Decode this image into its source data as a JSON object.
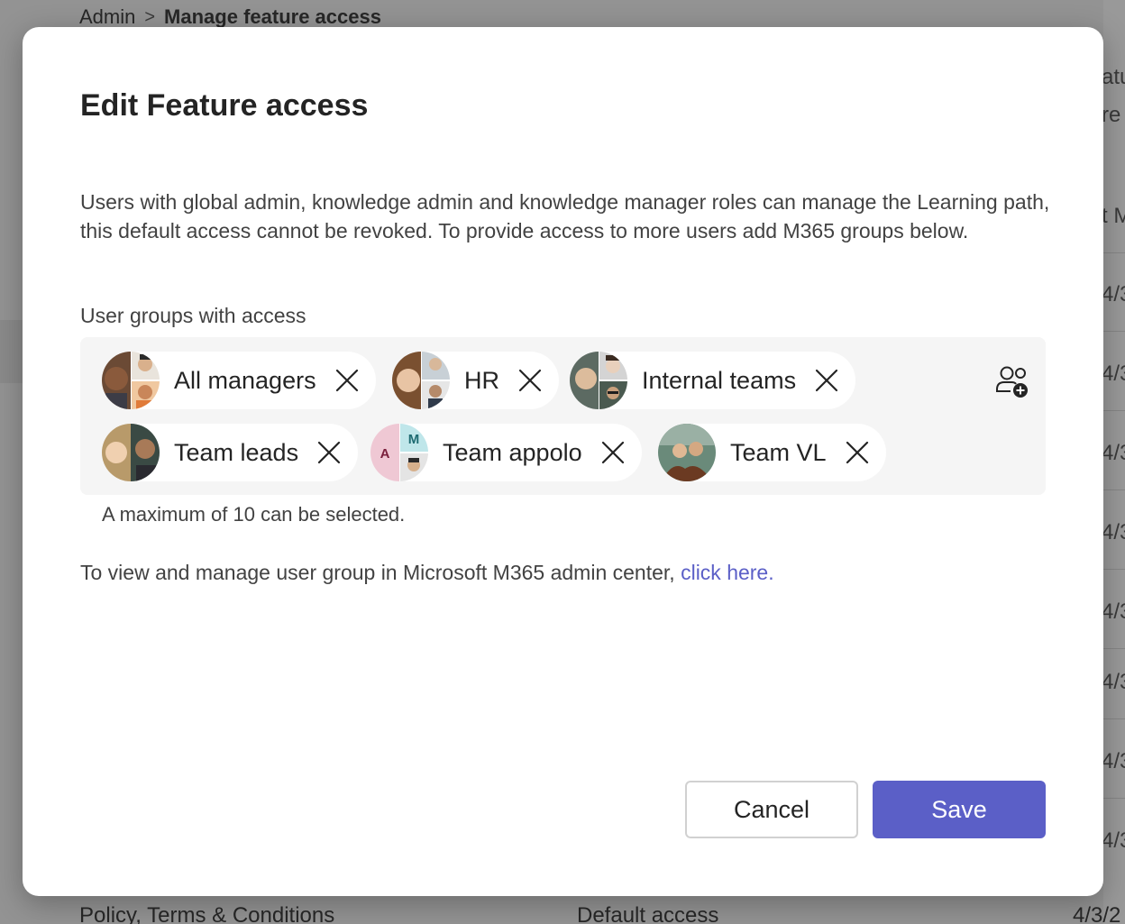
{
  "background": {
    "breadcrumb": {
      "root": "Admin",
      "separator": ">",
      "current": "Manage feature access"
    },
    "right_column_fragments": [
      "atu",
      "re",
      "t M",
      "4/3/2",
      "4/3/2",
      "4/3/2",
      "4/3/2",
      "4/3/2",
      "4/3/2",
      "4/3/2",
      "4/3/2"
    ],
    "bottom_row": {
      "name": "Policy, Terms & Conditions",
      "access": "Default access",
      "date": "4/3/2"
    }
  },
  "dialog": {
    "title": "Edit Feature access",
    "description": "Users with global admin, knowledge admin and knowledge manager roles can manage the Learning path, this default access cannot be revoked. To provide access to more users add M365 groups below.",
    "field_label": "User groups with access",
    "chips": [
      {
        "label": "All managers"
      },
      {
        "label": "HR"
      },
      {
        "label": "Internal teams"
      },
      {
        "label": "Team leads"
      },
      {
        "label": "Team appolo",
        "avatar_initials": [
          "A",
          "M"
        ]
      },
      {
        "label": "Team VL"
      }
    ],
    "add_icon": "add-people-icon",
    "helper_text": "A maximum of 10 can be selected.",
    "manage_text": "To view and manage user group in Microsoft M365 admin center, ",
    "manage_link": "click here.",
    "buttons": {
      "cancel": "Cancel",
      "save": "Save"
    },
    "colors": {
      "accent": "#5b5fc7",
      "link": "#5b5fc7"
    }
  }
}
